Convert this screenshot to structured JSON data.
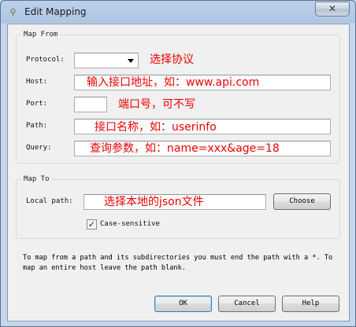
{
  "window": {
    "title": "Edit Mapping",
    "close_glyph": "✕"
  },
  "map_from": {
    "group_title": "Map From",
    "protocol_label": "Protocol:",
    "protocol_value": "",
    "host_label": "Host:",
    "host_value": "",
    "port_label": "Port:",
    "port_value": "",
    "path_label": "Path:",
    "path_value": "",
    "query_label": "Query:",
    "query_value": ""
  },
  "map_to": {
    "group_title": "Map To",
    "local_path_label": "Local path:",
    "local_path_value": "",
    "choose_label": "Choose",
    "case_sensitive_label": "Case-sensitive",
    "case_sensitive_checked": true
  },
  "annotations": {
    "protocol": "选择协议",
    "host": "输入接口地址，如：www.api.com",
    "port": "端口号，可不写",
    "path": "接口名称，如：userinfo",
    "query": "查询参数，如：name=xxx&age=18",
    "local_path": "选择本地的json文件"
  },
  "note": "To map from a path and its subdirectories you must end the path with a *. To map an entire host leave the path blank.",
  "footer": {
    "ok_label": "OK",
    "cancel_label": "Cancel",
    "help_label": "Help"
  },
  "colors": {
    "annotation": "#ee0000",
    "default_button_border": "#3c7fb1"
  },
  "icons": {
    "checkbox_mark": "✓"
  }
}
